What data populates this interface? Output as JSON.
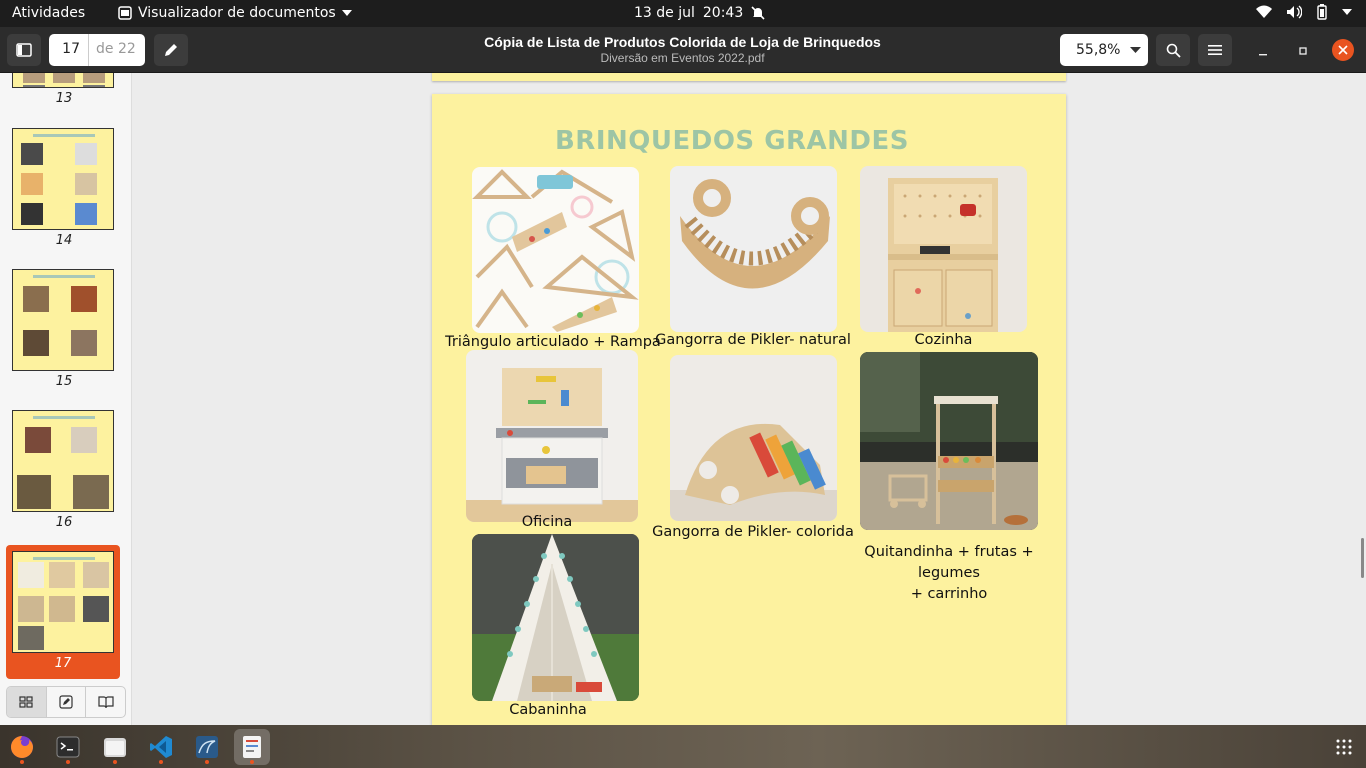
{
  "topbar": {
    "activities": "Atividades",
    "app_name": "Visualizador de documentos",
    "date": "13 de jul",
    "time": "20:43"
  },
  "header": {
    "page_current": "17",
    "page_total": "de 22",
    "title": "Cópia de Lista de Produtos Colorida de Loja de Brinquedos",
    "subtitle": "Diversão em Eventos 2022.pdf",
    "zoom": "55,8%"
  },
  "sidebar": {
    "thumbnails": [
      {
        "num": "13"
      },
      {
        "num": "14"
      },
      {
        "num": "15"
      },
      {
        "num": "16"
      },
      {
        "num": "17",
        "active": true
      }
    ]
  },
  "document": {
    "heading": "BRINQUEDOS GRANDES",
    "items": [
      {
        "label": "Triângulo articulado + Rampa"
      },
      {
        "label": "Gangorra de Pikler- natural"
      },
      {
        "label": "Cozinha"
      },
      {
        "label": "Oficina"
      },
      {
        "label": "Gangorra de Pikler- colorida"
      },
      {
        "label_lines": [
          "Quitandinha + frutas +",
          "legumes",
          "+ carrinho"
        ]
      },
      {
        "label": "Cabaninha"
      }
    ]
  },
  "colors": {
    "accent": "#e95420",
    "page_bg": "#fdf29f",
    "heading": "#9dc5a5"
  },
  "taskbar": [
    "firefox-icon",
    "terminal-icon",
    "files-icon",
    "vscode-icon",
    "mysql-workbench-icon",
    "document-viewer-icon"
  ]
}
